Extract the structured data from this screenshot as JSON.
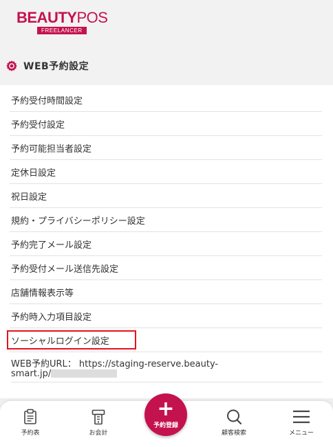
{
  "brand": {
    "logo_bold": "BEAUTY",
    "logo_light": "POS",
    "logo_sub": "FREELANCER"
  },
  "section": {
    "title": "WEB予約設定",
    "icon": "gear-icon",
    "accent": "#c4124f"
  },
  "menu": {
    "items": [
      {
        "label": "予約受付時間設定"
      },
      {
        "label": "予約受付設定"
      },
      {
        "label": "予約可能担当者設定"
      },
      {
        "label": "定休日設定"
      },
      {
        "label": "祝日設定"
      },
      {
        "label": "規約・プライバシーポリシー設定"
      },
      {
        "label": "予約完了メール設定"
      },
      {
        "label": "予約受付メール送信先設定"
      },
      {
        "label": "店舗情報表示等"
      },
      {
        "label": "予約時入力項目設定"
      },
      {
        "label": "ソーシャルログイン設定",
        "highlighted": true,
        "highlight_color": "#e8101b"
      }
    ]
  },
  "url": {
    "prefix": "WEB予約URL：",
    "value_line1": "https://staging-reserve.beauty-",
    "value_line2": "smart.jp/"
  },
  "bottom_nav": {
    "items": [
      {
        "label": "予約表",
        "icon": "reservation-table-icon"
      },
      {
        "label": "お会計",
        "icon": "register-icon"
      },
      {
        "label": "顧客検索",
        "icon": "search-icon"
      },
      {
        "label": "メニュー",
        "icon": "hamburger-menu-icon"
      }
    ],
    "fab": {
      "label": "予約登録",
      "icon": "plus-icon"
    }
  }
}
